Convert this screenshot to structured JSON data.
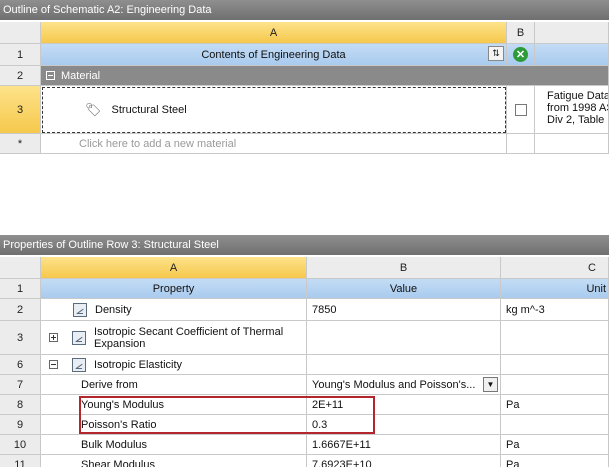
{
  "outline": {
    "title": "Outline of Schematic A2: Engineering Data",
    "col_a": "A",
    "col_b": "B",
    "rows": [
      {
        "num": "1",
        "a": "Contents of Engineering Data"
      },
      {
        "num": "2",
        "a": "Material"
      },
      {
        "num": "3",
        "a": "Structural Steel",
        "c": "Fatigue Data\nfrom 1998 AS\nDiv 2, Table"
      },
      {
        "num": "*",
        "a": "Click here to add a new material"
      }
    ]
  },
  "properties": {
    "title": "Properties of Outline Row 3: Structural Steel",
    "col_a": "A",
    "col_b": "B",
    "col_c": "C",
    "header": {
      "num": "1",
      "property": "Property",
      "value": "Value",
      "unit": "Unit"
    },
    "rows": [
      {
        "num": "2",
        "property": "Density",
        "value": "7850",
        "unit": "kg m^-3"
      },
      {
        "num": "3",
        "property": "Isotropic Secant Coefficient of Thermal Expansion",
        "value": "",
        "unit": ""
      },
      {
        "num": "6",
        "property": "Isotropic Elasticity",
        "value": "",
        "unit": ""
      },
      {
        "num": "7",
        "property": "Derive from",
        "value": "Young's Modulus and Poisson's...",
        "unit": ""
      },
      {
        "num": "8",
        "property": "Young's Modulus",
        "value": "2E+11",
        "unit": "Pa"
      },
      {
        "num": "9",
        "property": "Poisson's Ratio",
        "value": "0.3",
        "unit": ""
      },
      {
        "num": "10",
        "property": "Bulk Modulus",
        "value": "1.6667E+11",
        "unit": "Pa"
      },
      {
        "num": "11",
        "property": "Shear Modulus",
        "value": "7.6923E+10",
        "unit": "Pa"
      }
    ]
  },
  "colors": {
    "accent_red": "#b3262c",
    "selection": "#f6c84c",
    "header_blue": "#a9cbee"
  },
  "icons": [
    "sort-icon",
    "close-circle-icon",
    "material-tag-icon",
    "property-icon",
    "expand-icon",
    "collapse-icon",
    "dropdown-icon"
  ]
}
